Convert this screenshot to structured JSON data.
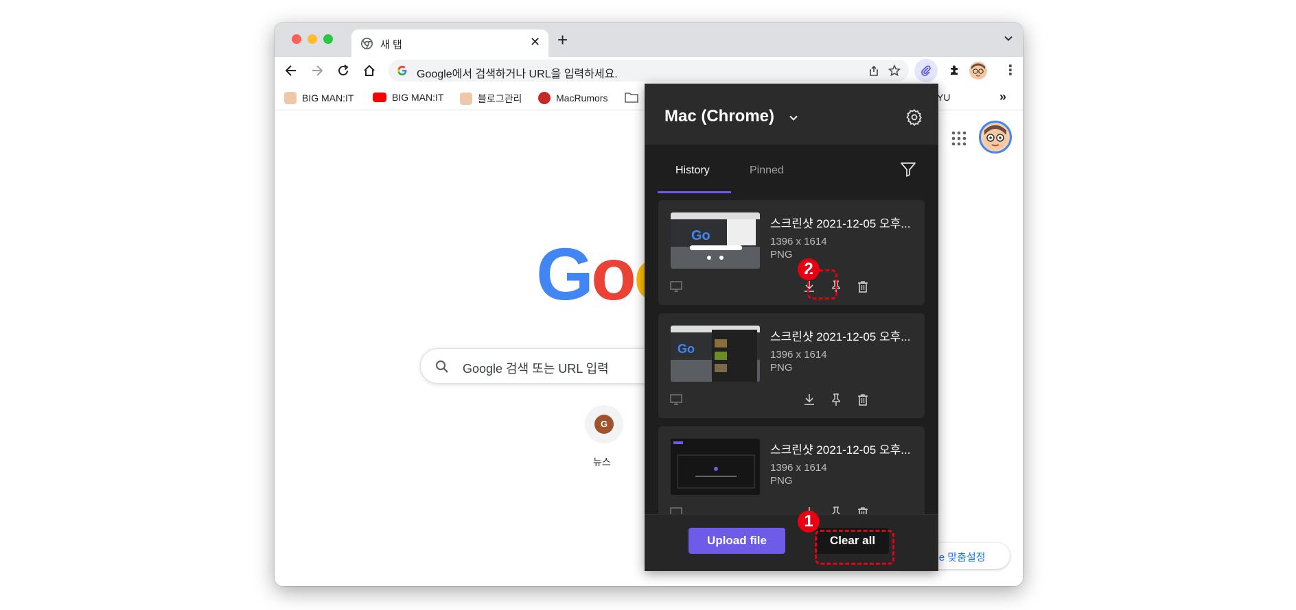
{
  "tab": {
    "title": "새 탭"
  },
  "omnibox": {
    "text": "Google에서 검색하거나 URL을 입력하세요."
  },
  "bookmarks": {
    "items": [
      {
        "label": "BIG MAN:IT",
        "color": "#f0c8a8"
      },
      {
        "label": "BIG MAN:IT",
        "color": "#ff0000"
      },
      {
        "label": "블로그관리",
        "color": "#f0c8a8"
      },
      {
        "label": "MacRumors",
        "color": "#c62828"
      }
    ],
    "partial": "YU",
    "more": "»"
  },
  "google": {
    "logo_letters": [
      "G",
      "o",
      "o"
    ],
    "logo_colors": [
      "#4285f4",
      "#ea4335",
      "#fbbc05"
    ],
    "search_placeholder": "Google 검색 또는 URL 입력",
    "shortcut_letter": "G",
    "shortcut_label": "뉴스",
    "customize_label": "ome 맞춤설정"
  },
  "panel": {
    "device_name": "Mac (Chrome)",
    "tabs": [
      {
        "label": "History",
        "active": true
      },
      {
        "label": "Pinned",
        "active": false
      }
    ],
    "items": [
      {
        "title": "스크린샷 2021-12-05 오후...",
        "dimensions": "1396 x 1614",
        "type": "PNG"
      },
      {
        "title": "스크린샷 2021-12-05 오후...",
        "dimensions": "1396 x 1614",
        "type": "PNG"
      },
      {
        "title": "스크린샷 2021-12-05 오후...",
        "dimensions": "1396 x 1614",
        "type": "PNG"
      }
    ],
    "upload_label": "Upload file",
    "clear_label": "Clear all",
    "accent": "#6c5ce7"
  },
  "annotations": [
    {
      "label": "1",
      "target": "clear-all-button"
    },
    {
      "label": "2",
      "target": "delete-icon"
    }
  ]
}
